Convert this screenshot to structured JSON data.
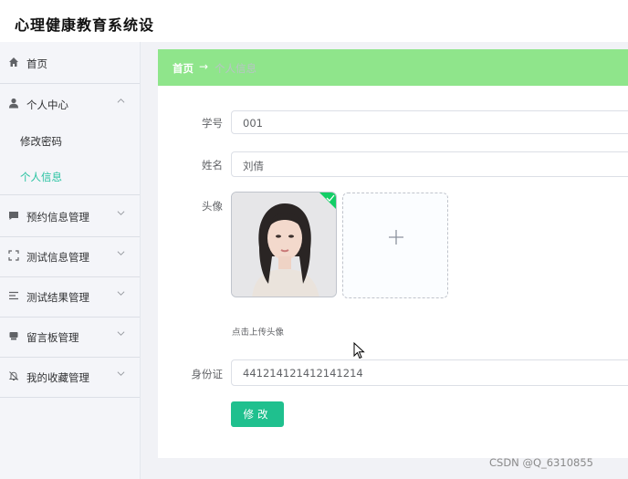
{
  "app": {
    "title": "心理健康教育系统设"
  },
  "sidebar": {
    "items": [
      {
        "label": "首页",
        "icon": "home-icon"
      },
      {
        "label": "个人中心",
        "icon": "user-icon",
        "expanded": true,
        "children": [
          {
            "label": "修改密码"
          },
          {
            "label": "个人信息",
            "active": true
          }
        ]
      },
      {
        "label": "预约信息管理",
        "icon": "chat-icon"
      },
      {
        "label": "测试信息管理",
        "icon": "fullscreen-icon"
      },
      {
        "label": "测试结果管理",
        "icon": "list-icon"
      },
      {
        "label": "留言板管理",
        "icon": "message-icon"
      },
      {
        "label": "我的收藏管理",
        "icon": "bell-off-icon"
      }
    ]
  },
  "breadcrumb": {
    "home": "首页",
    "separator": "→",
    "current": "个人信息"
  },
  "form": {
    "student_id_label": "学号",
    "student_id_value": "001",
    "name_label": "姓名",
    "name_value": "刘倩",
    "avatar_label": "头像",
    "upload_tip": "点击上传头像",
    "id_card_label": "身份证",
    "id_card_value": "441214121412141214",
    "submit_label": "修改"
  },
  "watermark": "CSDN @Q_6310855",
  "colors": {
    "accent": "#27c2a1",
    "breadcrumb_bg": "#8fe58b",
    "button": "#1fc08e"
  }
}
